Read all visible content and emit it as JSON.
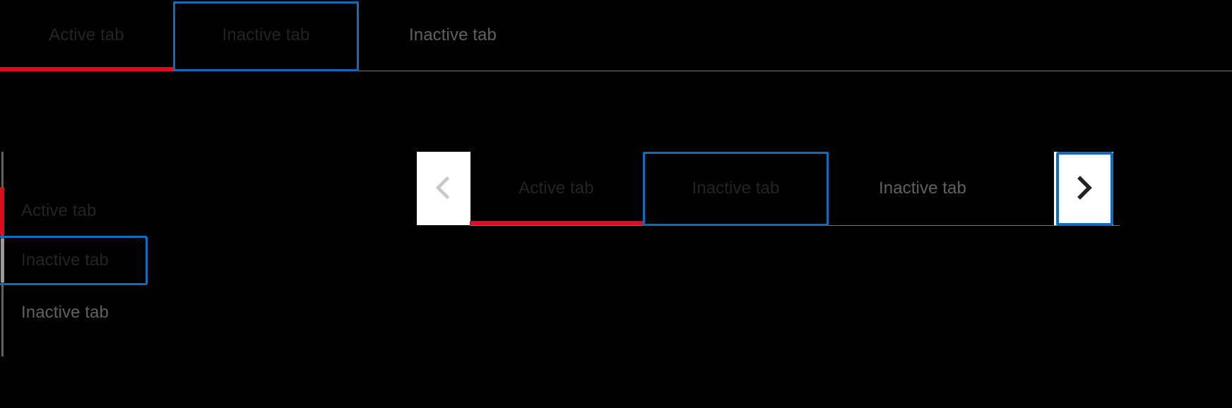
{
  "theme": {
    "background": "#000000",
    "accent_red": "#e00b1c",
    "focus_blue": "#0f6cbd",
    "rail_gray": "#757575",
    "secondary_indicator_gray": "#9a9a9a",
    "text_dark": "#242424",
    "text_rest": "#616161",
    "button_surface": "#ffffff",
    "chevron_disabled": "#c7c7c7",
    "chevron_enabled": "#242424"
  },
  "horizontal_tablist_top": {
    "name": "horizontal-tablist",
    "orientation": "horizontal",
    "selected_index": 0,
    "focused_index": 1,
    "tabs": [
      {
        "label": "Active tab",
        "state": "selected"
      },
      {
        "label": "Inactive tab",
        "state": "focused"
      },
      {
        "label": "Inactive tab",
        "state": "rest"
      }
    ]
  },
  "vertical_tablist": {
    "name": "vertical-tablist",
    "orientation": "vertical",
    "selected_index": 0,
    "focused_index": 1,
    "tabs": [
      {
        "label": "Active tab",
        "state": "selected"
      },
      {
        "label": "Inactive tab",
        "state": "focused"
      },
      {
        "label": "Inactive tab",
        "state": "rest"
      }
    ]
  },
  "scrollable_tablist": {
    "name": "scrollable-tablist",
    "orientation": "horizontal",
    "selected_index": 0,
    "focused_index": 1,
    "prev_button": {
      "icon": "chevron-left-icon",
      "glyph": "‹",
      "state": "disabled"
    },
    "next_button": {
      "icon": "chevron-right-icon",
      "glyph": "›",
      "state": "focused"
    },
    "tabs": [
      {
        "label": "Active tab",
        "state": "selected"
      },
      {
        "label": "Inactive tab",
        "state": "focused"
      },
      {
        "label": "Inactive tab",
        "state": "rest"
      }
    ]
  }
}
